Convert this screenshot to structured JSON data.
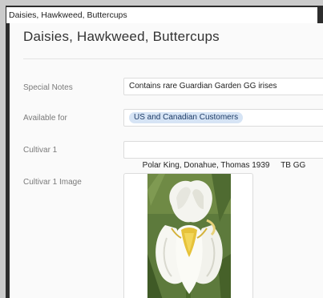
{
  "window": {
    "title": "Daisies, Hawkweed, Buttercups"
  },
  "record": {
    "heading": "Daisies, Hawkweed, Buttercups",
    "fields": [
      {
        "label": "Special Notes",
        "value": "Contains rare Guardian Garden GG irises"
      },
      {
        "label": "Available for",
        "tag": "US and Canadian Customers"
      },
      {
        "label": "Cultivar 1",
        "value": "Polar King, Donahue, Thomas 1939     TB GG"
      },
      {
        "label": "Cultivar 1 Image"
      }
    ]
  },
  "colors": {
    "tag_bg": "#d6e4f5",
    "tag_text": "#1d3b66",
    "window_bg": "#2d2d2d",
    "content_bg": "#fafafa"
  },
  "image": {
    "subject": "white iris flower with yellow beard",
    "icon": "photo-thumbnail"
  }
}
